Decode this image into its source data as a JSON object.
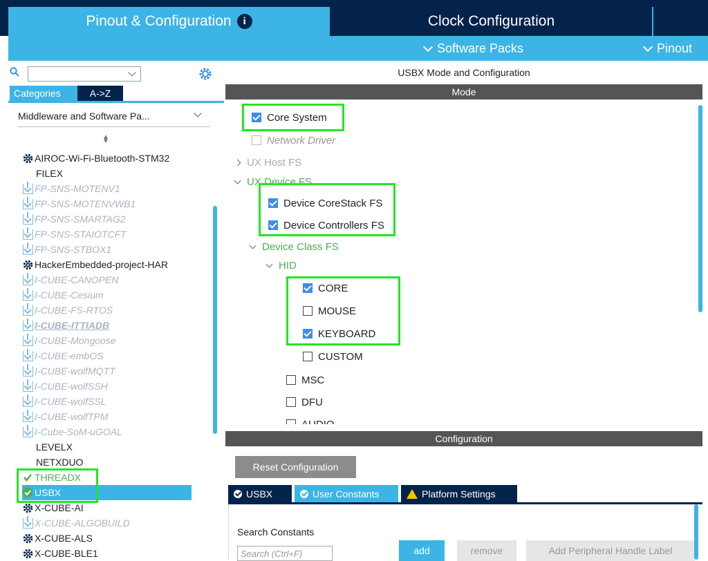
{
  "tabs": {
    "pinout": "Pinout & Configuration",
    "clock": "Clock Configuration"
  },
  "menu": {
    "software_packs": "Software Packs",
    "pinout": "Pinout"
  },
  "left": {
    "category_tab": "Categories",
    "az_tab": "A->Z",
    "category_select": "Middleware and Software Pa...",
    "items": [
      {
        "label": "AIROC-Wi-Fi-Bluetooth-STM32",
        "kind": "gear"
      },
      {
        "label": "FILEX",
        "kind": "plain"
      },
      {
        "label": "FP-SNS-MOTENV1",
        "kind": "pack"
      },
      {
        "label": "FP-SNS-MOTENVWB1",
        "kind": "pack"
      },
      {
        "label": "FP-SNS-SMARTAG2",
        "kind": "pack"
      },
      {
        "label": "FP-SNS-STAIOTCFT",
        "kind": "pack"
      },
      {
        "label": "FP-SNS-STBOX1",
        "kind": "pack"
      },
      {
        "label": "HackerEmbedded-project-HAR",
        "kind": "gear"
      },
      {
        "label": "I-CUBE-CANOPEN",
        "kind": "pack"
      },
      {
        "label": "I-CUBE-Cesium",
        "kind": "pack"
      },
      {
        "label": "I-CUBE-FS-RTOS",
        "kind": "pack"
      },
      {
        "label": "I-CUBE-ITTIADB",
        "kind": "pack-ul"
      },
      {
        "label": "I-CUBE-Mongoose",
        "kind": "pack"
      },
      {
        "label": "I-CUBE-embOS",
        "kind": "pack"
      },
      {
        "label": "I-CUBE-wolfMQTT",
        "kind": "pack"
      },
      {
        "label": "I-CUBE-wolfSSH",
        "kind": "pack"
      },
      {
        "label": "I-CUBE-wolfSSL",
        "kind": "pack"
      },
      {
        "label": "I-CUBE-wolfTPM",
        "kind": "pack"
      },
      {
        "label": "I-Cube-SoM-uGOAL",
        "kind": "pack"
      },
      {
        "label": "LEVELX",
        "kind": "plain"
      },
      {
        "label": "NETXDUO",
        "kind": "plain"
      },
      {
        "label": "THREADX",
        "kind": "green"
      },
      {
        "label": "USBX",
        "kind": "selected"
      },
      {
        "label": "X-CUBE-AI",
        "kind": "gear"
      },
      {
        "label": "X-CUBE-ALGOBUILD",
        "kind": "pack"
      },
      {
        "label": "X-CUBE-ALS",
        "kind": "gear"
      },
      {
        "label": "X-CUBE-BLE1",
        "kind": "gear"
      }
    ]
  },
  "right": {
    "title": "USBX Mode and Configuration",
    "mode_header": "Mode",
    "mode": {
      "core_system": "Core System",
      "network_driver": "Network Driver",
      "ux_host_fs": "UX Host FS",
      "ux_device_fs": "UX Device FS",
      "device_corestack_fs": "Device CoreStack FS",
      "device_controllers_fs": "Device Controllers FS",
      "device_class_fs": "Device Class FS",
      "hid": "HID",
      "core": "CORE",
      "mouse": "MOUSE",
      "keyboard": "KEYBOARD",
      "custom": "CUSTOM",
      "msc": "MSC",
      "dfu": "DFU",
      "audio": "AUDIO"
    },
    "config_header": "Configuration",
    "reset_button": "Reset Configuration",
    "config_tabs": {
      "usbx": "USBX",
      "user_constants": "User Constants",
      "platform_settings": "Platform Settings"
    },
    "search_label": "Search Constants",
    "search_placeholder": "Search (Ctrl+F)",
    "add_button": "add",
    "remove_button": "remove",
    "add_handle_button": "Add Peripheral Handle Label"
  },
  "colors": {
    "navy": "#03234b",
    "accent": "#3cb4e6",
    "highlight": "#22e622",
    "enabled_green": "#4caf50"
  }
}
